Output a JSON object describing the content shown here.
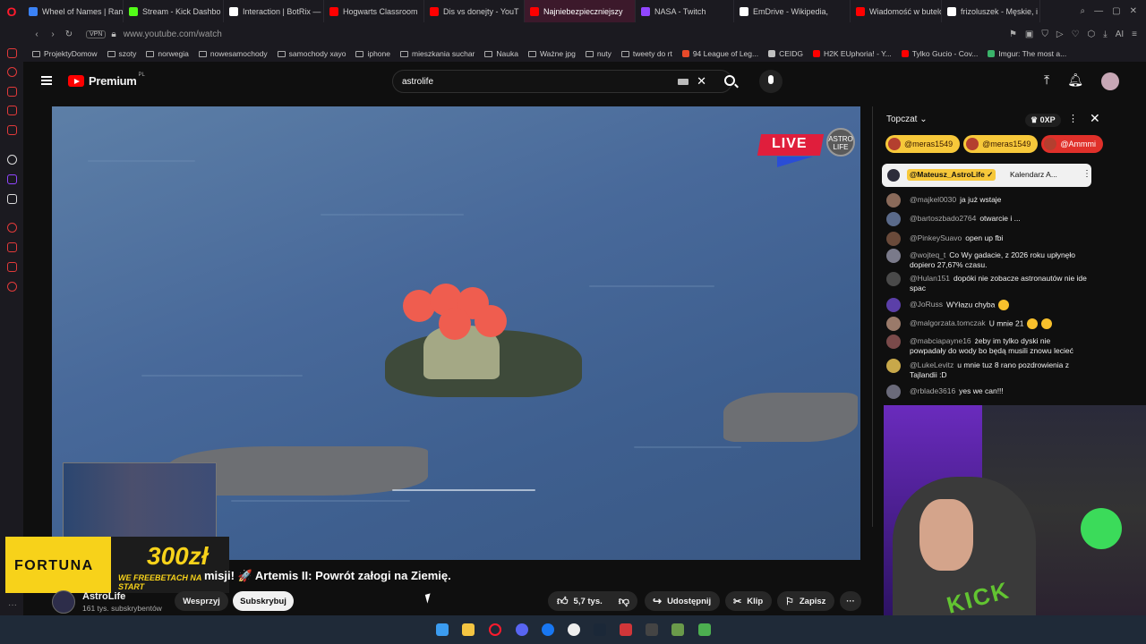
{
  "browser": {
    "tabs": [
      {
        "label": "Wheel of Names | Ran",
        "color": "#3b82f6"
      },
      {
        "label": "Stream - Kick Dashbo",
        "color": "#53fc18"
      },
      {
        "label": "Interaction | BotRix —",
        "color": "#ffffff"
      },
      {
        "label": "Hogwarts Classroom",
        "color": "#ff0000"
      },
      {
        "label": "Dis vs donejty - YouT",
        "color": "#ff0000"
      },
      {
        "label": "Najniebezpieczniejszy",
        "color": "#ff0000",
        "active": true
      },
      {
        "label": "NASA - Twitch",
        "color": "#9146ff"
      },
      {
        "label": "EmDrive - Wikipedia,",
        "color": "#ffffff"
      },
      {
        "label": "Wiadomość w butelc",
        "color": "#ff0000"
      },
      {
        "label": "frizoluszek - Męskie, i",
        "color": "#ffffff"
      }
    ],
    "vpn_label": "VPN",
    "url": "www.youtube.com/watch",
    "ai_label": "AI",
    "bookmarks": [
      {
        "label": "ProjektyDomow",
        "type": "folder"
      },
      {
        "label": "szoty",
        "type": "folder"
      },
      {
        "label": "norwegia",
        "type": "folder"
      },
      {
        "label": "nowesamochody",
        "type": "folder"
      },
      {
        "label": "samochody xayo",
        "type": "folder"
      },
      {
        "label": "iphone",
        "type": "folder"
      },
      {
        "label": "mieszkania suchar",
        "type": "folder"
      },
      {
        "label": "Nauka",
        "type": "folder"
      },
      {
        "label": "Ważne jpg",
        "type": "folder"
      },
      {
        "label": "nuty",
        "type": "folder"
      },
      {
        "label": "tweety do rt",
        "type": "folder"
      },
      {
        "label": "94 League of Leg...",
        "type": "site",
        "color": "#e84a2a"
      },
      {
        "label": "CEIDG",
        "type": "site",
        "color": "#c0c0c0"
      },
      {
        "label": "H2K EUphoria! - Y...",
        "type": "site",
        "color": "#ff0000"
      },
      {
        "label": "Tylko Gucio - Cov...",
        "type": "site",
        "color": "#ff0000"
      },
      {
        "label": "Imgur: The most a...",
        "type": "site",
        "color": "#3ab36a"
      }
    ]
  },
  "youtube": {
    "logo_text": "Premium",
    "logo_region": "PL",
    "search_query": "astrolife",
    "video": {
      "live_text": "LIVE",
      "badge_text": "ASTRO LIFE",
      "title": "misji! 🚀 Artemis II: Powrót załogi na Ziemię.",
      "ad_brand": "FORTUNA",
      "ad_amount": "300zł",
      "ad_promo": "WE FREEBETACH NA START"
    },
    "channel": {
      "name": "AstroLife",
      "subscribers": "161 tys. subskrybentów",
      "support_label": "Wesprzyj",
      "subscribe_label": "Subskrybuj"
    },
    "actions": {
      "likes": "5,7 tys.",
      "share": "Udostępnij",
      "clip": "Klip",
      "save": "Zapisz"
    }
  },
  "chat": {
    "mode_label": "Topczat",
    "xp": "0XP",
    "donors": [
      "@meras1549",
      "@meras1549",
      "@Ammmi"
    ],
    "pinned": {
      "name": "@Mateusz_AstroLife ✓",
      "text": "Kalendarz A..."
    },
    "messages": [
      {
        "name": "@majkel0030",
        "text": "ja już wstaje",
        "color": "#8a6a5a"
      },
      {
        "name": "@bartoszbado2764",
        "text": "otwarcie i ...",
        "color": "#5a6a8a"
      },
      {
        "name": "@PinkeySuavo",
        "text": "open up fbi",
        "color": "#6a4a3a"
      },
      {
        "name": "@wojteq_t",
        "text": "Co Wy gadacie, z 2026 roku upłynęło dopiero 27,67% czasu.",
        "color": "#7a7a8a"
      },
      {
        "name": "@Hulan151",
        "text": "dopóki nie zobacze astronautów nie ide spac",
        "color": "#4a4a4a"
      },
      {
        "name": "@JoRuss",
        "text": "WYłazu chyba",
        "color": "#5b3fa8"
      },
      {
        "name": "@malgorzata.tomczak",
        "text": "U mnie 21",
        "color": "#9a7a6a"
      },
      {
        "name": "@mabciapayne16",
        "text": "żeby im tylko dyski nie powpadały do wody bo będą musili znowu lecieć",
        "color": "#7a4a4a"
      },
      {
        "name": "@LukeLevitz",
        "text": "u mnie tuz 8 rano pozdrowienia z Tajlandii :D",
        "color": "#c8a84a"
      },
      {
        "name": "@rblade3616",
        "text": "yes we can!!!",
        "color": "#6a6a7a"
      }
    ]
  },
  "stream_overlay": {
    "brand": "KICK"
  }
}
